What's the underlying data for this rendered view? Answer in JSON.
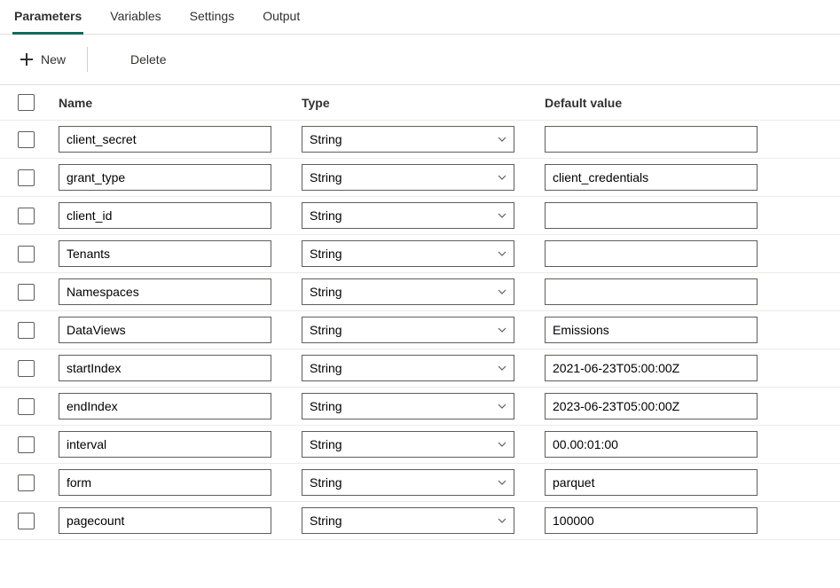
{
  "tabs": [
    {
      "label": "Parameters",
      "active": true
    },
    {
      "label": "Variables",
      "active": false
    },
    {
      "label": "Settings",
      "active": false
    },
    {
      "label": "Output",
      "active": false
    }
  ],
  "toolbar": {
    "new_label": "New",
    "delete_label": "Delete"
  },
  "columns": {
    "name": "Name",
    "type": "Type",
    "default": "Default value"
  },
  "rows": [
    {
      "name": "client_secret",
      "type": "String",
      "default": ""
    },
    {
      "name": "grant_type",
      "type": "String",
      "default": "client_credentials"
    },
    {
      "name": "client_id",
      "type": "String",
      "default": ""
    },
    {
      "name": "Tenants",
      "type": "String",
      "default": ""
    },
    {
      "name": "Namespaces",
      "type": "String",
      "default": ""
    },
    {
      "name": "DataViews",
      "type": "String",
      "default": "Emissions"
    },
    {
      "name": "startIndex",
      "type": "String",
      "default": "2021-06-23T05:00:00Z"
    },
    {
      "name": "endIndex",
      "type": "String",
      "default": "2023-06-23T05:00:00Z"
    },
    {
      "name": "interval",
      "type": "String",
      "default": "00.00:01:00"
    },
    {
      "name": "form",
      "type": "String",
      "default": "parquet"
    },
    {
      "name": "pagecount",
      "type": "String",
      "default": "100000"
    }
  ]
}
